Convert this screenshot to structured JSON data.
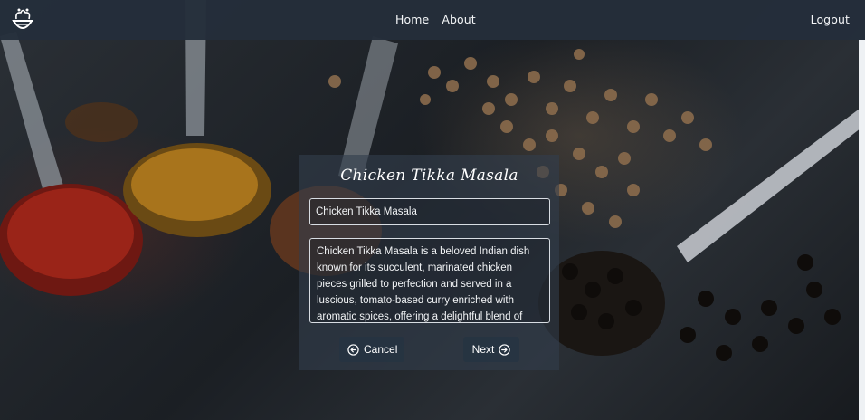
{
  "nav": {
    "logo_icon": "chef-bowl-logo-icon",
    "links": [
      {
        "label": "Home"
      },
      {
        "label": "About"
      }
    ],
    "logout_label": "Logout"
  },
  "form": {
    "title": "Chicken Tikka Masala",
    "name_value": "Chicken Tikka Masala",
    "description_value": "Chicken Tikka Masala is a beloved Indian dish known for its succulent, marinated chicken pieces grilled to perfection and served in a luscious, tomato-based curry enriched with aromatic spices, offering a delightful blend of flavours and textures.",
    "cancel_label": "Cancel",
    "cancel_icon": "arrow-left-circle-icon",
    "next_label": "Next",
    "next_icon": "arrow-right-circle-icon"
  },
  "background": {
    "subject": "spoons of spices on dark slate",
    "colors": {
      "slate": "#1b1f24",
      "paprika": "#8a1f18",
      "turmeric": "#b07a1c",
      "coriander": "#8a6a48",
      "pepper": "#15110e"
    }
  }
}
